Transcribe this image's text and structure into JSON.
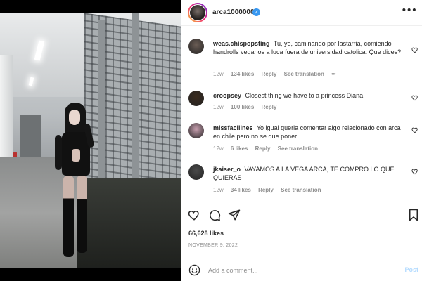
{
  "post": {
    "username": "arca1000000",
    "verified": true,
    "more_icon": "more-horizontal-icon"
  },
  "comments": [
    {
      "username": "weas.chispopsting",
      "text": "Tu, yo, caminando por lastarria, comiendo handrolls veganos a luca fuera de universidad catolica. Que dices?",
      "age": "12w",
      "likes": "134 likes",
      "reply": "Reply",
      "translation": "See translation",
      "has_more": true,
      "avatar_color": "#6b5d55"
    },
    {
      "username": "croopsey",
      "text": "Closest thing we have to a princess Diana",
      "age": "12w",
      "likes": "100 likes",
      "reply": "Reply",
      "translation": "",
      "has_more": false,
      "avatar_color": "#3a2b1e"
    },
    {
      "username": "missfacilines",
      "text": "Yo igual queria comentar algo relacionado con arca en chile pero no se que poner",
      "age": "12w",
      "likes": "6 likes",
      "reply": "Reply",
      "translation": "See translation",
      "has_more": false,
      "avatar_color": "#c9a0b0"
    },
    {
      "username": "jkaiser_o",
      "text": "VAYAMOS A LA VEGA ARCA, TE COMPRO LO QUE QUIERAS",
      "age": "12w",
      "likes": "34 likes",
      "reply": "Reply",
      "translation": "See translation",
      "has_more": false,
      "avatar_color": "#4a4a4a"
    }
  ],
  "actions": {
    "like_icon": "heart-icon",
    "comment_icon": "comment-icon",
    "share_icon": "share-icon",
    "save_icon": "bookmark-icon"
  },
  "likes_count": "66,628 likes",
  "date": "NOVEMBER 9, 2022",
  "add_comment": {
    "placeholder": "Add a comment...",
    "post_label": "Post",
    "emoji_icon": "emoji-icon"
  },
  "colors": {
    "accent": "#0095f6",
    "verified": "#3897f0",
    "muted": "#8e8e8e",
    "post_disabled": "#b3dbff"
  }
}
